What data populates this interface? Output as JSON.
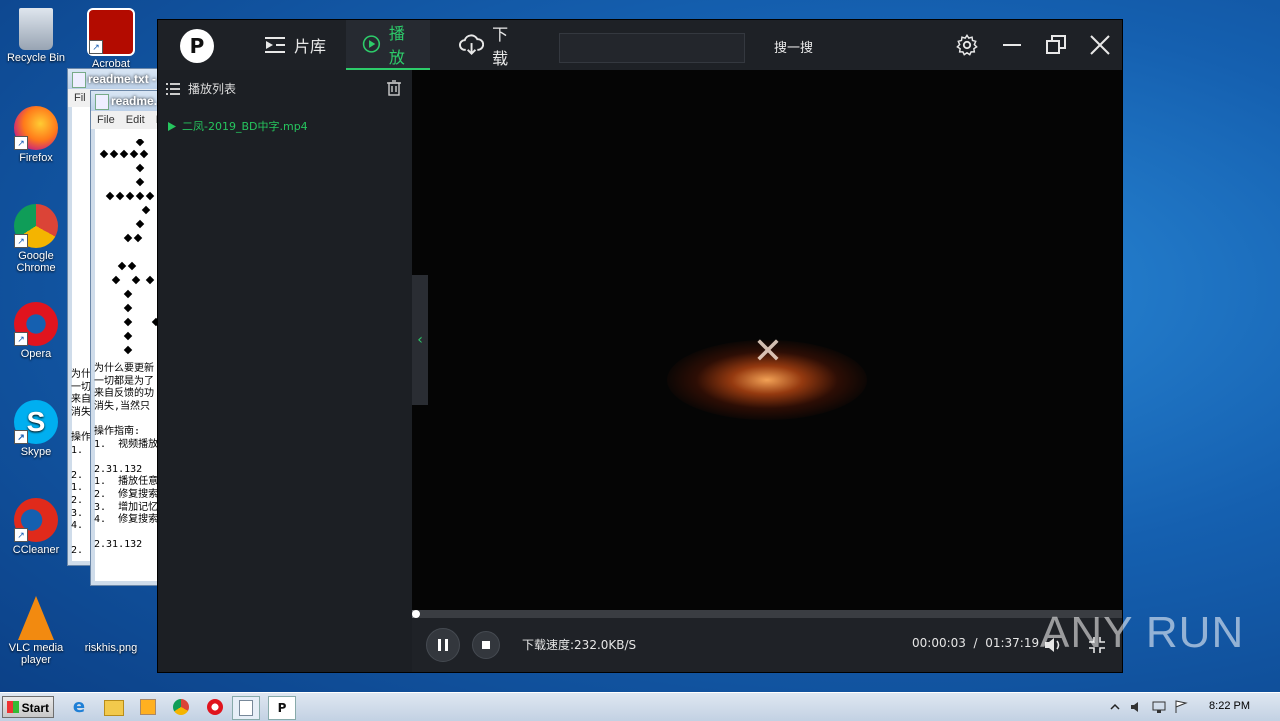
{
  "desktop": {
    "icons": [
      {
        "label": "Recycle Bin"
      },
      {
        "label": "Acrobat"
      },
      {
        "label": "Firefox"
      },
      {
        "label": "Google Chrome"
      },
      {
        "label": "Opera"
      },
      {
        "label": "Skype"
      },
      {
        "label": "CCleaner"
      },
      {
        "label": "VLC media player"
      },
      {
        "label": "riskhis.png"
      }
    ]
  },
  "notepad_back": {
    "title": "readme.txt -",
    "menu": "Fil",
    "body_lines": [
      "为什",
      "一切",
      "来自",
      "消失",
      "",
      "操作",
      "1.",
      "",
      "2.",
      "1.",
      "2.",
      "3.",
      "4.",
      "",
      "2."
    ]
  },
  "notepad_front": {
    "title": "readme.",
    "menu": "File  Edit  F",
    "body_lines": [
      "为什么要更新",
      "一切都是为了",
      "来自反馈的功",
      "消失,当然只",
      "",
      "操作指南:",
      "1.  视频播放",
      "",
      "2.31.132",
      "1.  播放任意",
      "2.  修复搜索",
      "3.  增加记忆",
      "4.  修复搜索",
      "",
      "2.31.132"
    ]
  },
  "player": {
    "logo": "P",
    "tabs": [
      {
        "label": "片库",
        "icon": "library-icon"
      },
      {
        "label": "播放",
        "icon": "play-circle-icon"
      },
      {
        "label": "下载",
        "icon": "cloud-download-icon"
      }
    ],
    "search": {
      "value": "",
      "button_label": "搜一搜"
    },
    "playlist": {
      "title": "播放列表",
      "items": [
        {
          "name": "二凤-2019_BD中字.mp4"
        }
      ]
    },
    "status": {
      "download_speed": "下载速度:232.0KB/S",
      "current_time": "00:00:03",
      "total_time": "01:37:19",
      "progress": 0.0005
    }
  },
  "watermark": "ANY RUN",
  "taskbar": {
    "start_label": "Start",
    "clock": "8:22 PM"
  }
}
